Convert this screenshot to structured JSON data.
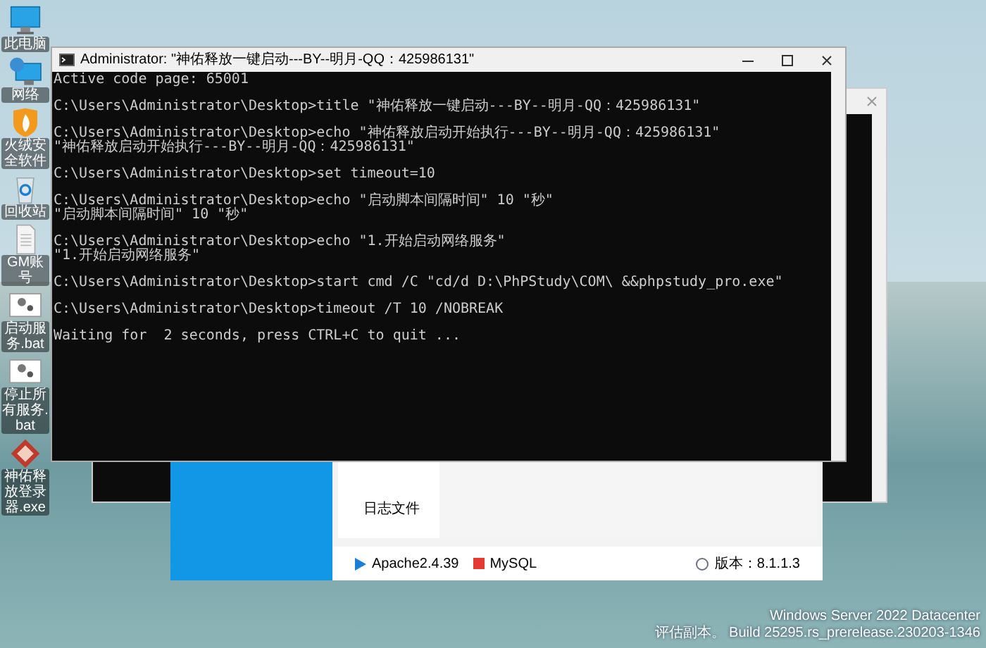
{
  "desktop_icons": [
    {
      "label": "此电脑",
      "kind": "computer"
    },
    {
      "label": "网络",
      "kind": "network"
    },
    {
      "label": "火绒安全软件",
      "kind": "shield"
    },
    {
      "label": "回收站",
      "kind": "recycle"
    },
    {
      "label": "GM账号",
      "kind": "document"
    },
    {
      "label": "启动服务.bat",
      "kind": "batch"
    },
    {
      "label": "停止所有服务.bat",
      "kind": "batch"
    },
    {
      "label": "神佑释放登录器.exe",
      "kind": "app"
    }
  ],
  "console": {
    "title": "Administrator: \"神佑释放一键启动---BY--明月-QQ：425986131\"",
    "blocks": [
      [
        "Active code page: 65001"
      ],
      [
        "C:\\Users\\Administrator\\Desktop>title \"神佑释放一键启动---BY--明月-QQ：425986131\""
      ],
      [
        "C:\\Users\\Administrator\\Desktop>echo \"神佑释放启动开始执行---BY--明月-QQ：425986131\"",
        "\"神佑释放启动开始执行---BY--明月-QQ：425986131\""
      ],
      [
        "C:\\Users\\Administrator\\Desktop>set timeout=10"
      ],
      [
        "C:\\Users\\Administrator\\Desktop>echo \"启动脚本间隔时间\" 10 \"秒\"",
        "\"启动脚本间隔时间\" 10 \"秒\""
      ],
      [
        "C:\\Users\\Administrator\\Desktop>echo \"1.开始启动网络服务\"",
        "\"1.开始启动网络服务\""
      ],
      [
        "C:\\Users\\Administrator\\Desktop>start cmd /C \"cd/d D:\\PhPStudy\\COM\\ &&phpstudy_pro.exe\""
      ],
      [
        "C:\\Users\\Administrator\\Desktop>timeout /T 10 /NOBREAK"
      ],
      [
        "Waiting for  2 seconds, press CTRL+C to quit ..."
      ]
    ]
  },
  "phpstudy": {
    "menu_item": "日志文件",
    "services": [
      {
        "name": "Apache2.4.39",
        "running": true
      },
      {
        "name": "MySQL",
        "running": false
      }
    ],
    "version": "版本：8.1.1.3"
  },
  "os_info": [
    "Windows Server 2022 Datacenter",
    "评估副本。 Build 25295.rs_prerelease.230203-1346"
  ]
}
